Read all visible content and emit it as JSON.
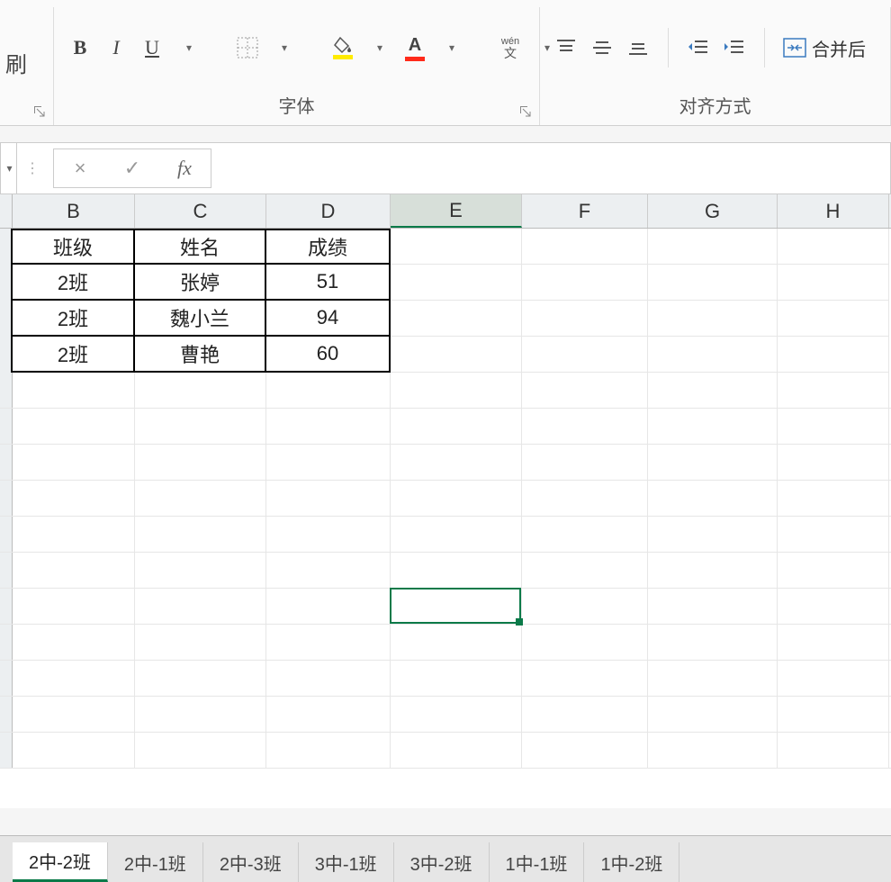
{
  "ribbon": {
    "clipboard": {
      "brush_label": "刷"
    },
    "font": {
      "group_label": "字体",
      "bold": "B",
      "italic": "I",
      "underline": "U",
      "wen_top": "wén",
      "wen_bot": "文"
    },
    "align": {
      "group_label": "对齐方式",
      "merge_label": "合并后"
    }
  },
  "formula_bar": {
    "cancel": "×",
    "accept": "✓",
    "fx": "fx",
    "value": ""
  },
  "columns": [
    "B",
    "C",
    "D",
    "E",
    "F",
    "G",
    "H"
  ],
  "active_column": "E",
  "table": {
    "headers": [
      "班级",
      "姓名",
      "成绩"
    ],
    "rows": [
      [
        "2班",
        "张婷",
        "51"
      ],
      [
        "2班",
        "魏小兰",
        "94"
      ],
      [
        "2班",
        "曹艳",
        "60"
      ]
    ]
  },
  "active_cell": {
    "col": "E",
    "row_index": 10
  },
  "sheet_tabs": [
    "2中-2班",
    "2中-1班",
    "2中-3班",
    "3中-1班",
    "3中-2班",
    "1中-1班",
    "1中-2班"
  ],
  "active_tab_index": 0
}
